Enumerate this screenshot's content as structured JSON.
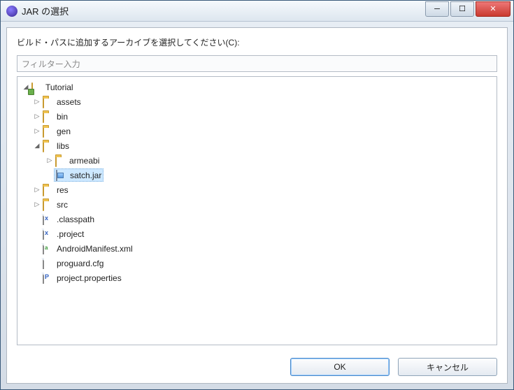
{
  "window": {
    "title": "JAR の選択"
  },
  "instruction": "ビルド・パスに追加するアーカイブを選択してください(C):",
  "filter": {
    "placeholder": "フィルター入力"
  },
  "tree": {
    "root": {
      "label": "Tutorial"
    },
    "assets": {
      "label": "assets"
    },
    "bin": {
      "label": "bin"
    },
    "gen": {
      "label": "gen"
    },
    "libs": {
      "label": "libs"
    },
    "armeabi": {
      "label": "armeabi"
    },
    "satchjar": {
      "label": "satch.jar"
    },
    "res": {
      "label": "res"
    },
    "src": {
      "label": "src"
    },
    "classpath": {
      "label": ".classpath"
    },
    "project": {
      "label": ".project"
    },
    "manifest": {
      "label": "AndroidManifest.xml"
    },
    "proguard": {
      "label": "proguard.cfg"
    },
    "properties": {
      "label": "project.properties"
    }
  },
  "buttons": {
    "ok": "OK",
    "cancel": "キャンセル"
  }
}
